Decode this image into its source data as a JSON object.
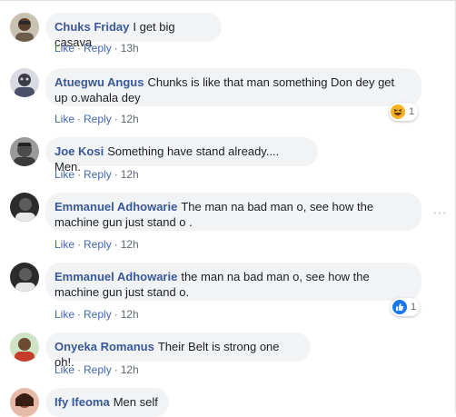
{
  "comments": [
    {
      "author": "Chuks Friday",
      "text": "I get big casava",
      "like": "Like",
      "reply": "Reply",
      "time": "13h"
    },
    {
      "author": "Atuegwu Angus",
      "text": "Chunks is like that man something Don dey get up o.wahala dey",
      "like": "Like",
      "reply": "Reply",
      "time": "12h",
      "reaction_count": "1",
      "reaction_icon": "haha-icon"
    },
    {
      "author": "Joe Kosi",
      "text": "Something have stand already.... Men.",
      "like": "Like",
      "reply": "Reply",
      "time": "12h"
    },
    {
      "author": "Emmanuel Adhowarie",
      "text": "The man na bad man o, see how the machine gun just stand o .",
      "like": "Like",
      "reply": "Reply",
      "time": "12h"
    },
    {
      "author": "Emmanuel Adhowarie",
      "text": "the man na bad man o, see how the machine gun just stand o.",
      "like": "Like",
      "reply": "Reply",
      "time": "12h",
      "reaction_count": "1",
      "reaction_icon": "like-icon"
    },
    {
      "author": "Onyeka Romanus",
      "text": "Their Belt is strong one oh!.",
      "like": "Like",
      "reply": "Reply",
      "time": "12h"
    },
    {
      "author": "Ify Ifeoma",
      "text": "Men self"
    }
  ],
  "separator": "·",
  "more_glyph": "···",
  "colors": {
    "author": "#385898",
    "link": "#4267b2",
    "bubble": "#f2f3f5",
    "meta": "#606770"
  }
}
